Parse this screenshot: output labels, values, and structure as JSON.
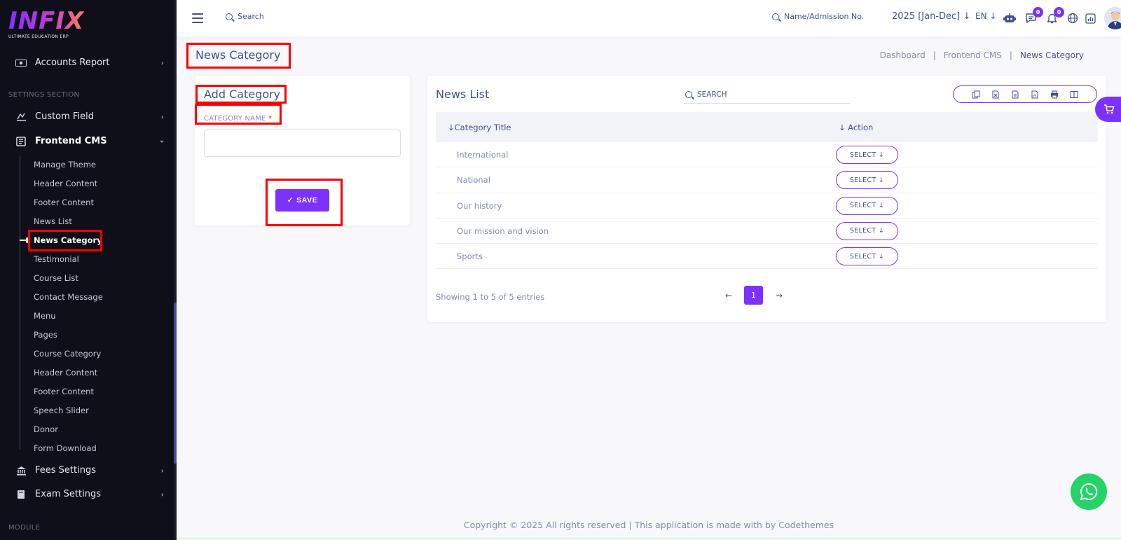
{
  "brand": {
    "logo_text": "INFIX",
    "logo_subtitle": "ULTIMATE EDUCATION ERP"
  },
  "sidebar": {
    "top_items": [
      {
        "label": "Accounts Report",
        "icon": "report-icon"
      }
    ],
    "settings_section_label": "SETTINGS SECTION",
    "settings_items": [
      {
        "label": "Custom Field",
        "icon": "custom-field-icon"
      },
      {
        "label": "Frontend CMS",
        "icon": "cms-icon",
        "expanded": true
      }
    ],
    "frontend_cms_subitems": [
      "Manage Theme",
      "Header Content",
      "Footer Content",
      "News List",
      "News Category",
      "Testimonial",
      "Course List",
      "Contact Message",
      "Menu",
      "Pages",
      "Course Category",
      "Header Content",
      "Footer Content",
      "Speech Slider",
      "Donor",
      "Form Download"
    ],
    "active_subitem": "News Category",
    "bottom_items": [
      {
        "label": "Fees Settings",
        "icon": "bank-icon"
      },
      {
        "label": "Exam Settings",
        "icon": "book-icon"
      }
    ],
    "module_section_label": "MODULE"
  },
  "header": {
    "search_label": "Search",
    "name_search_label": "Name/Admission No.",
    "year_label": "2025 [Jan-Dec]",
    "language_label": "EN",
    "messages_count": "0",
    "notifications_count": "0"
  },
  "page": {
    "title": "News Category",
    "breadcrumb": [
      "Dashboard",
      "Frontend CMS",
      "News Category"
    ]
  },
  "add_form": {
    "title": "Add Category",
    "field_label": "CATEGORY NAME",
    "required_mark": "*",
    "field_value": "",
    "save_label": "SAVE"
  },
  "news_list": {
    "title": "News List",
    "search_placeholder": "SEARCH",
    "columns": [
      "Category Title",
      "Action"
    ],
    "rows": [
      {
        "title": "International",
        "action": "SELECT"
      },
      {
        "title": "National",
        "action": "SELECT"
      },
      {
        "title": "Our history",
        "action": "SELECT"
      },
      {
        "title": "Our mission and vision",
        "action": "SELECT"
      },
      {
        "title": "Sports",
        "action": "SELECT"
      }
    ],
    "showing_text": "Showing 1 to 5 of 5 entries",
    "current_page": "1",
    "export_buttons": [
      "copy-icon",
      "excel-icon",
      "csv-icon",
      "pdf-icon",
      "print-icon",
      "columns-icon"
    ]
  },
  "footer": {
    "copyright": "Copyright © 2025 All rights reserved | This application is made with by Codethemes"
  },
  "colors": {
    "accent": "#7c32ff",
    "text": "#415094",
    "muted": "#828bb2",
    "sidebar_bg": "#0f0f1a",
    "highlight": "#ff0000",
    "whatsapp": "#25d366"
  }
}
